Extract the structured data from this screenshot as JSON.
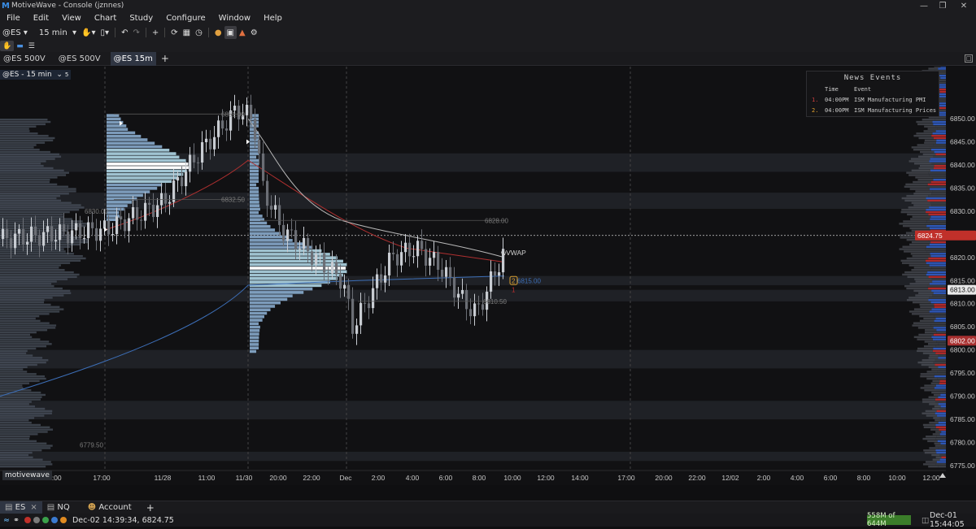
{
  "app": {
    "title": "MotiveWave - Console (jznnes)"
  },
  "menu": [
    "File",
    "Edit",
    "View",
    "Chart",
    "Study",
    "Configure",
    "Window",
    "Help"
  ],
  "toolbar": {
    "symbol": "@ES",
    "interval": "15 min"
  },
  "tabs": [
    {
      "label": "@ES 500V",
      "active": false
    },
    {
      "label": "@ES 500V",
      "active": false
    },
    {
      "label": "@ES 15m",
      "active": true
    }
  ],
  "chart": {
    "header_label": "@ES - 15 min",
    "header_count": "5",
    "watermark": "motivewave",
    "price_labels": [
      "6850.00",
      "6845.00",
      "6840.00",
      "6835.00",
      "6830.00",
      "6825.00",
      "6820.00",
      "6815.00",
      "6810.00",
      "6805.00",
      "6800.00",
      "6795.00",
      "6790.00",
      "6785.00",
      "6780.00",
      "6775.00"
    ],
    "highlighted_prices": {
      "high": "6864.50",
      "current": "6824.75",
      "value_area": "6813.00",
      "low": "6802.00"
    },
    "time_labels": [
      "8:00",
      "10:00",
      "17:00",
      "11/28",
      "11:00",
      "11/30",
      "20:00",
      "22:00",
      "Dec",
      "2:00",
      "4:00",
      "6:00",
      "8:00",
      "10:00",
      "12:00",
      "14:00",
      "17:00",
      "20:00",
      "22:00",
      "12/02",
      "2:00",
      "4:00",
      "6:00",
      "8:00",
      "10:00",
      "12:00"
    ],
    "annotations": {
      "level_6851": "6851.00",
      "level_6832": "6832.50",
      "level_6828": "6828.00",
      "level_6810": "6810.50",
      "level_6779": "6779.50",
      "level_6830": "6830.00",
      "vwap_label": "wVWAP",
      "level_6815": "6815.00",
      "marker_1": "1",
      "marker_2": "2"
    },
    "colors": {
      "up": "#c8ccd2",
      "down": "#6b6e75",
      "profile": "#8fb4d8",
      "poc": "#ffffff",
      "vwap": "#3d6fb8",
      "ema_red": "#b03030",
      "ema_white": "#b8b8b8",
      "bid": "#2f58b8",
      "ask": "#b02a2a"
    }
  },
  "news": {
    "title": "News Events",
    "col_time": "Time",
    "col_event": "Event",
    "items": [
      {
        "n": "1.",
        "time": "04:00PM",
        "event": "ISM Manufacturing PMI"
      },
      {
        "n": "2.",
        "time": "04:00PM",
        "event": "ISM Manufacturing Prices"
      }
    ]
  },
  "bottom_tabs": [
    {
      "label": "ES",
      "active": true
    },
    {
      "label": "NQ",
      "active": false
    },
    {
      "label": "Account",
      "active": false
    }
  ],
  "status": {
    "quote": "Dec-02 14:39:34, 6824.75",
    "memory": "558M of 644M",
    "clock": "Dec-01 15:44:05"
  }
}
